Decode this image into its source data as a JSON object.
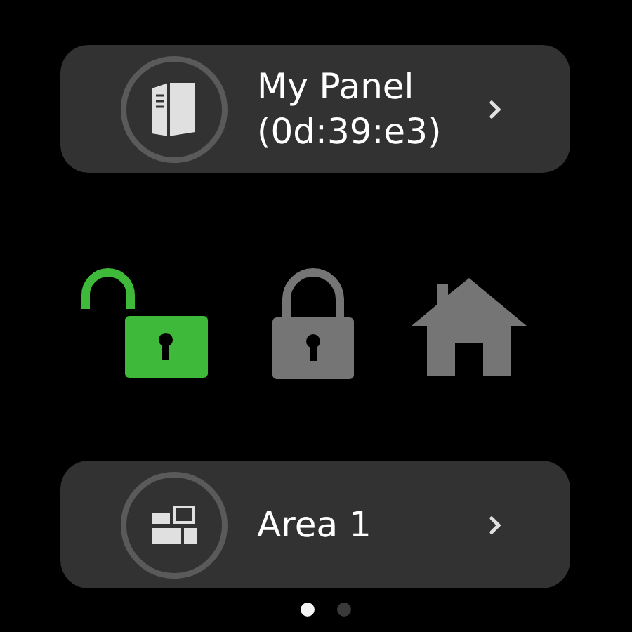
{
  "panel": {
    "title": "My Panel",
    "subtitle": "(0d:39:e3)"
  },
  "actions": [
    {
      "kind": "unlock",
      "active": true
    },
    {
      "kind": "lock",
      "active": false
    },
    {
      "kind": "home",
      "active": false
    }
  ],
  "area": {
    "title": "Area 1"
  },
  "pages": [
    {
      "selected": true
    },
    {
      "selected": false
    }
  ]
}
